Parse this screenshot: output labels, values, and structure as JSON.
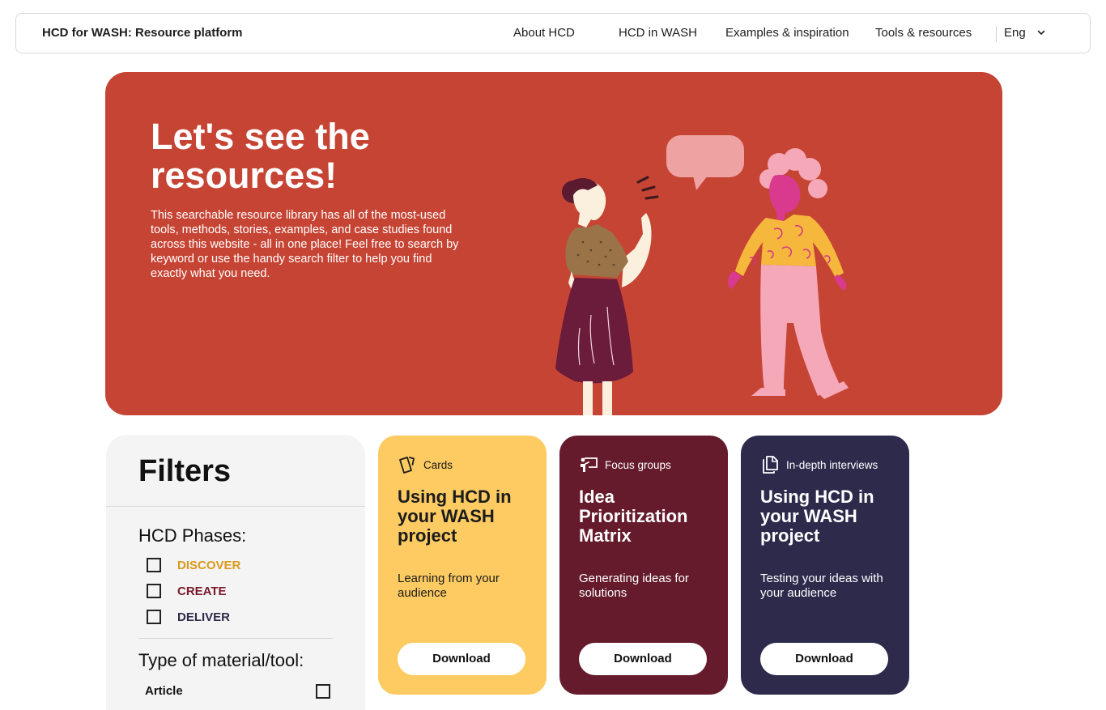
{
  "nav": {
    "brand": "HCD for WASH: Resource platform",
    "links": [
      "About HCD",
      "HCD in WASH",
      "Examples & inspiration",
      "Tools & resources"
    ],
    "language": "Eng",
    "language_icon": "chevron-down-icon"
  },
  "hero": {
    "title": "Let's see the resources!",
    "description": "This searchable resource library has all of the most-used tools, methods, stories, examples, and case studies found across this website - all in one place! Feel free to search by keyword or use the handy search filter to help you find exactly what you need.",
    "background_color": "#c64434"
  },
  "filters": {
    "title": "Filters",
    "phases_title": "HCD Phases:",
    "phases": [
      {
        "label": "DISCOVER",
        "color": "#d99a1d",
        "checked": false
      },
      {
        "label": "CREATE",
        "color": "#7a1a2b",
        "checked": false
      },
      {
        "label": "DELIVER",
        "color": "#2f2b4a",
        "checked": false
      }
    ],
    "material_title": "Type of material/tool:",
    "materials": [
      {
        "label": "Article",
        "checked": false
      }
    ]
  },
  "cards": [
    {
      "category": "Cards",
      "icon": "cards-icon",
      "title": "Using HCD in your WASH project",
      "description": "Learning from your audience",
      "button": "Download",
      "background": "#fdcb62",
      "text_color": "#1b1b1b"
    },
    {
      "category": "Focus groups",
      "icon": "presenter-icon",
      "title": "Idea Prioritization Matrix",
      "description": "Generating ideas for solutions",
      "button": "Download",
      "background": "#651b2c",
      "text_color": "#ffffff"
    },
    {
      "category": "In-depth interviews",
      "icon": "documents-icon",
      "title": "Using HCD in your WASH project",
      "description": "Testing your ideas with your audience",
      "button": "Download",
      "background": "#2d2a4c",
      "text_color": "#ffffff"
    }
  ]
}
